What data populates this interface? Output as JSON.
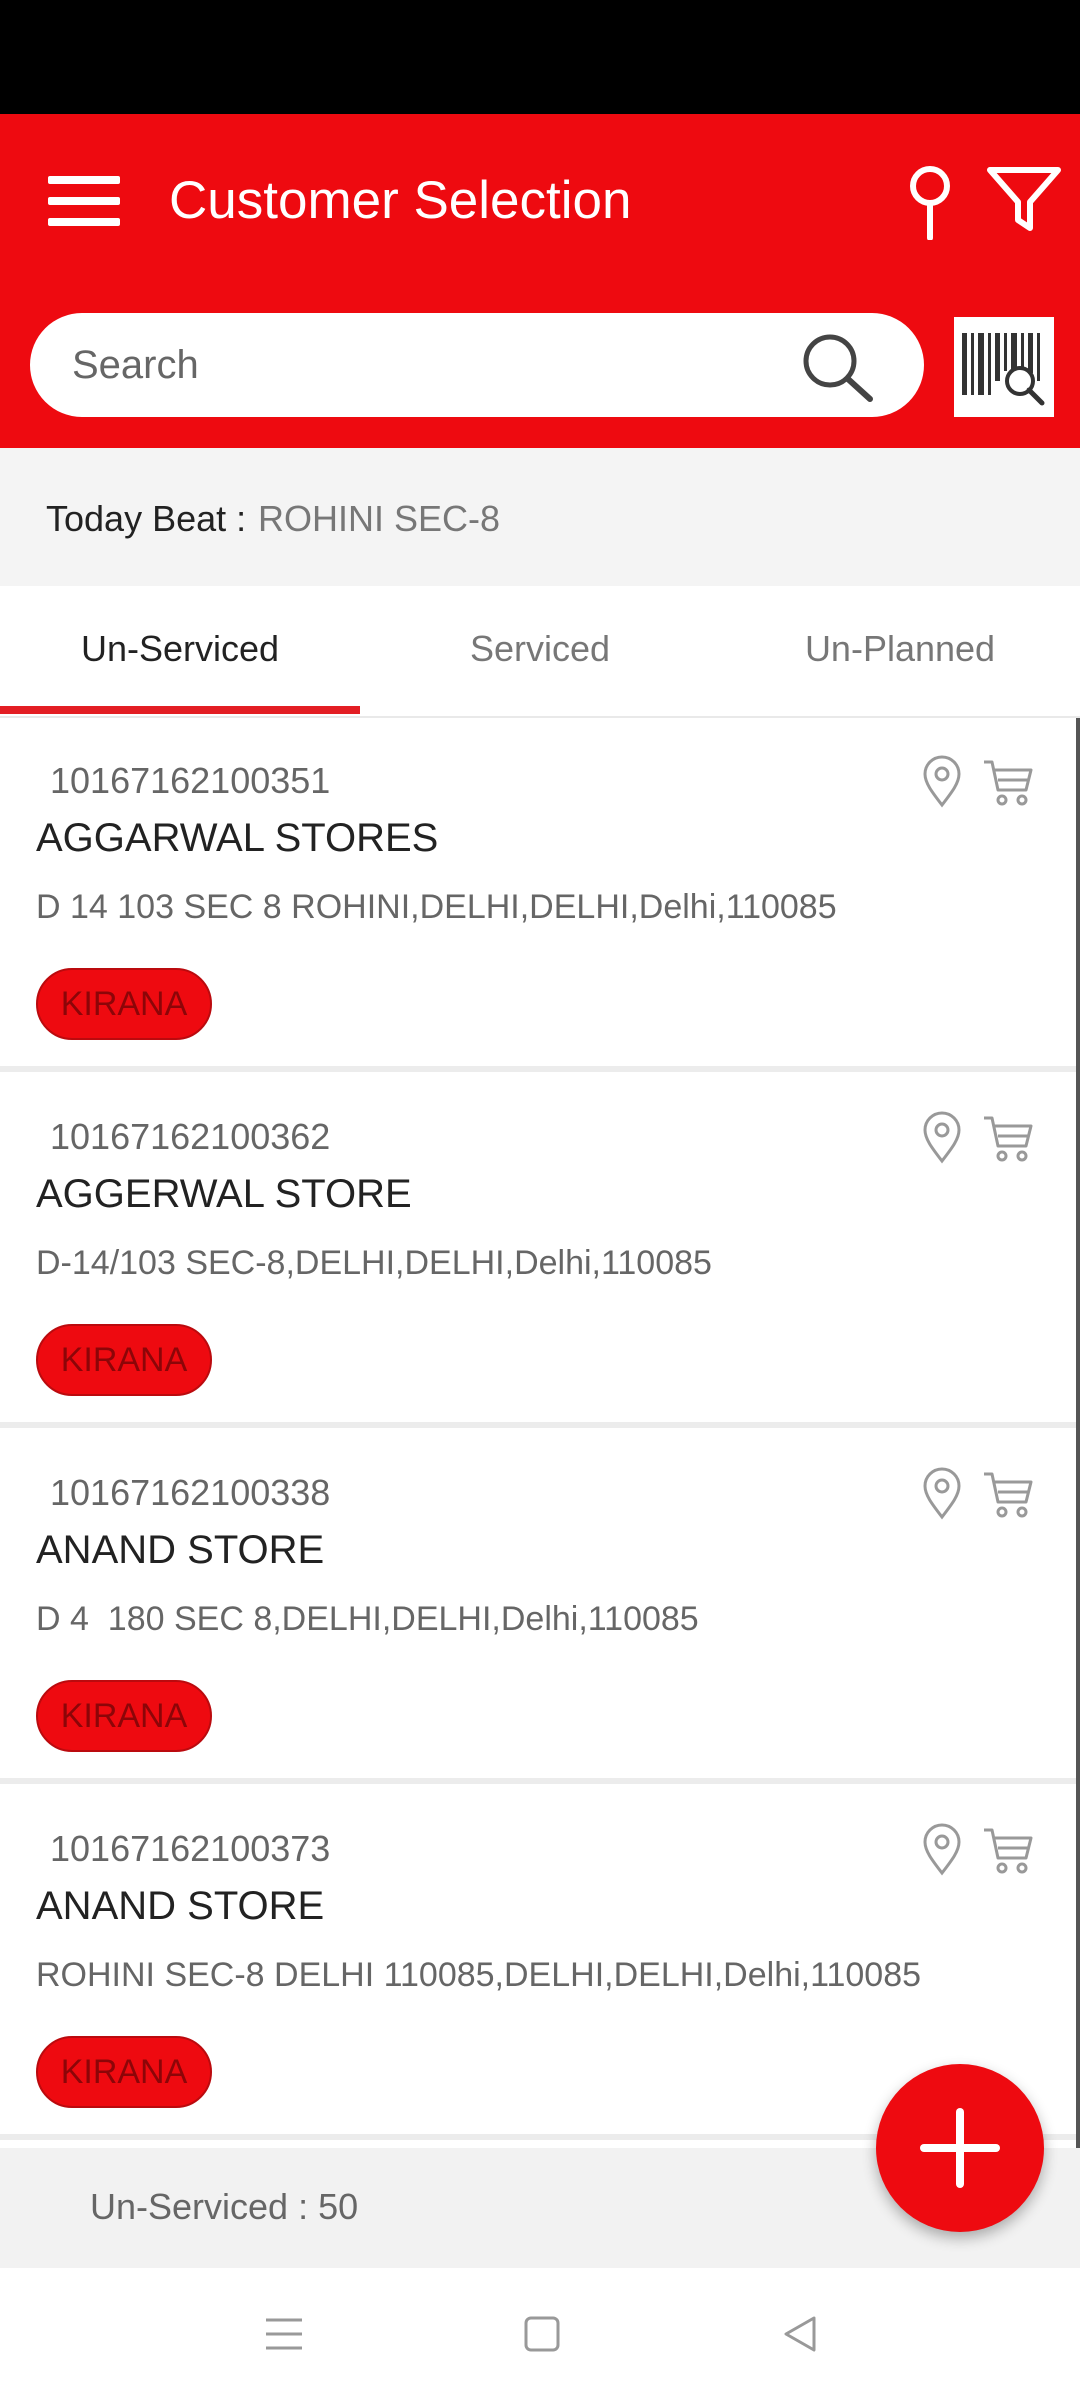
{
  "header": {
    "title": "Customer Selection",
    "menu_icon": "hamburger-menu-icon",
    "location_icon": "map-pin-icon",
    "filter_icon": "filter-funnel-icon"
  },
  "search": {
    "placeholder": "Search",
    "search_icon": "magnifier-icon",
    "barcode_icon": "barcode-scan-icon"
  },
  "beat": {
    "label": "Today Beat :",
    "value": "ROHINI SEC-8"
  },
  "tabs": [
    {
      "label": "Un-Serviced",
      "active": true
    },
    {
      "label": "Serviced",
      "active": false
    },
    {
      "label": "Un-Planned",
      "active": false
    }
  ],
  "customers": [
    {
      "code": "10167162100351",
      "name": "AGGARWAL STORES",
      "address": "D 14 103 SEC 8 ROHINI,DELHI,DELHI,Delhi,110085",
      "category": "KIRANA"
    },
    {
      "code": "10167162100362",
      "name": "AGGERWAL STORE",
      "address": "D-14/103 SEC-8,DELHI,DELHI,Delhi,110085",
      "category": "KIRANA"
    },
    {
      "code": "10167162100338",
      "name": "ANAND STORE",
      "address": "D 4  180 SEC 8,DELHI,DELHI,Delhi,110085",
      "category": "KIRANA"
    },
    {
      "code": "10167162100373",
      "name": "ANAND STORE",
      "address": "ROHINI SEC-8 DELHI 110085,DELHI,DELHI,Delhi,110085",
      "category": "KIRANA"
    }
  ],
  "footer": {
    "count_text": "Un-Serviced : 50"
  },
  "fab": {
    "icon": "plus-icon"
  },
  "colors": {
    "brand_red": "#ee0a10",
    "tab_indicator": "#e31e24"
  }
}
